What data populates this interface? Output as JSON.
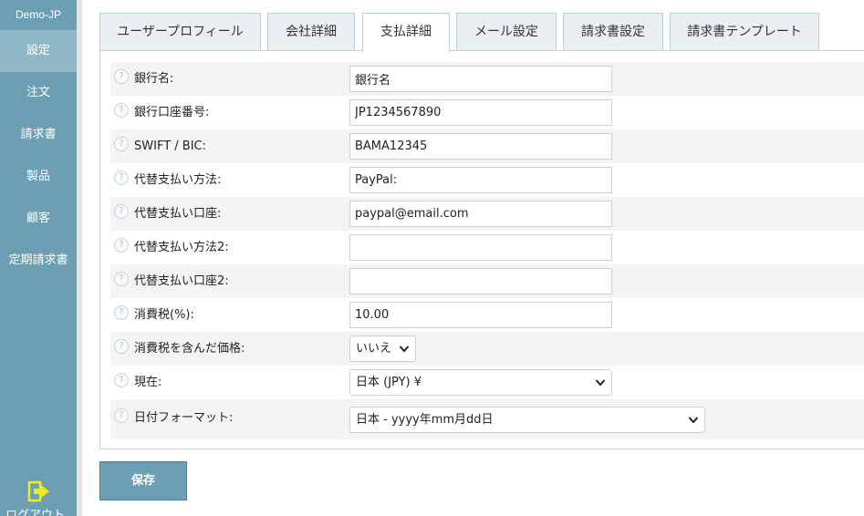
{
  "sidebar": {
    "brand": "Demo-JP",
    "items": [
      {
        "label": "設定",
        "active": true
      },
      {
        "label": "注文"
      },
      {
        "label": "請求書"
      },
      {
        "label": "製品"
      },
      {
        "label": "顧客"
      },
      {
        "label": "定期請求書"
      }
    ],
    "logout_label": "ログアウト",
    "logout_icon": "logout-icon"
  },
  "tabs": [
    {
      "label": "ユーザープロフィール"
    },
    {
      "label": "会社詳細"
    },
    {
      "label": "支払詳細",
      "active": true
    },
    {
      "label": "メール設定"
    },
    {
      "label": "請求書設定"
    },
    {
      "label": "請求書テンプレート"
    }
  ],
  "form": {
    "rows": [
      {
        "label": "銀行名:",
        "value": "銀行名"
      },
      {
        "label": "銀行口座番号:",
        "value": "JP1234567890"
      },
      {
        "label": "SWIFT / BIC:",
        "value": "BAMA12345"
      },
      {
        "label": "代替支払い方法:",
        "value": "PayPal:"
      },
      {
        "label": "代替支払い口座:",
        "value": "paypal@email.com"
      },
      {
        "label": "代替支払い方法2:",
        "value": ""
      },
      {
        "label": "代替支払い口座2:",
        "value": ""
      },
      {
        "label": "消費税(%):",
        "value": "10.00"
      },
      {
        "label": "消費税を含んだ価格:",
        "value": "いいえ"
      },
      {
        "label": "現在:",
        "value": "日本 (JPY) ¥"
      },
      {
        "label": "日付フォーマット:",
        "value": "日本 - yyyy年mm月dd日"
      }
    ]
  },
  "save_label": "保存",
  "colors": {
    "sidebar": "#6c9fb3",
    "sidebar_active": "#8fb7c7",
    "tab_bg": "#eaf0f2",
    "logout_icon": "#f2ea1c"
  }
}
